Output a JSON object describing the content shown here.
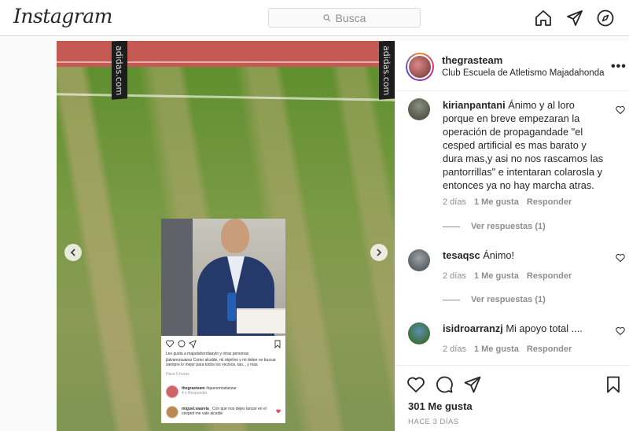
{
  "app": {
    "logo": "Instagram"
  },
  "search": {
    "placeholder": "Busca"
  },
  "nav": {
    "icons": [
      "home-icon",
      "direct-icon",
      "explore-icon"
    ]
  },
  "media": {
    "flag_text_left": "adidas.com",
    "flag_text_right": "adidas.com",
    "inset": {
      "likes_text": "Les gusta a majadahondaayto y otras personas",
      "caption": "jlalvarezsuarez Como alcalde, mi objetivo y mi deber es buscar siempre lo mejor para todos los vecinos, tan... y más",
      "time": "Hace 5 horas",
      "comment1_user": "thegrasteam",
      "comment1_text": "#queremoslanzar",
      "comment1_meta": "4 s  Responder",
      "comment2_user": "miguel.vaarela_",
      "comment2_text": "Con que nos dejes lanzar en el césped me vale alcalde"
    }
  },
  "post": {
    "username": "thegrasteam",
    "subtitle": "Club Escuela de Atletismo Majadahonda",
    "more": "•••",
    "likes": "301 Me gusta",
    "time_ago": "HACE 3 DÍAS"
  },
  "comments": [
    {
      "user": "kirianpantani",
      "text": "Ánimo y al loro porque en breve empezaran la operación de propagandade \"el cesped artificial es mas barato y dura mas,y asi no nos rascamos las pantorrillas\" e intentaran colarosla y entonces ya no hay marcha atras.",
      "age": "2 días",
      "likes": "1 Me gusta",
      "reply": "Responder",
      "replies": "Ver respuestas (1)"
    },
    {
      "user": "tesaqsc",
      "text": "Ánimo!",
      "age": "2 días",
      "likes": "1 Me gusta",
      "reply": "Responder",
      "replies": "Ver respuestas (1)"
    },
    {
      "user": "isidroarranzj",
      "text": "Mi apoyo total ....",
      "age": "2 días",
      "likes": "1 Me gusta",
      "reply": "Responder"
    }
  ]
}
